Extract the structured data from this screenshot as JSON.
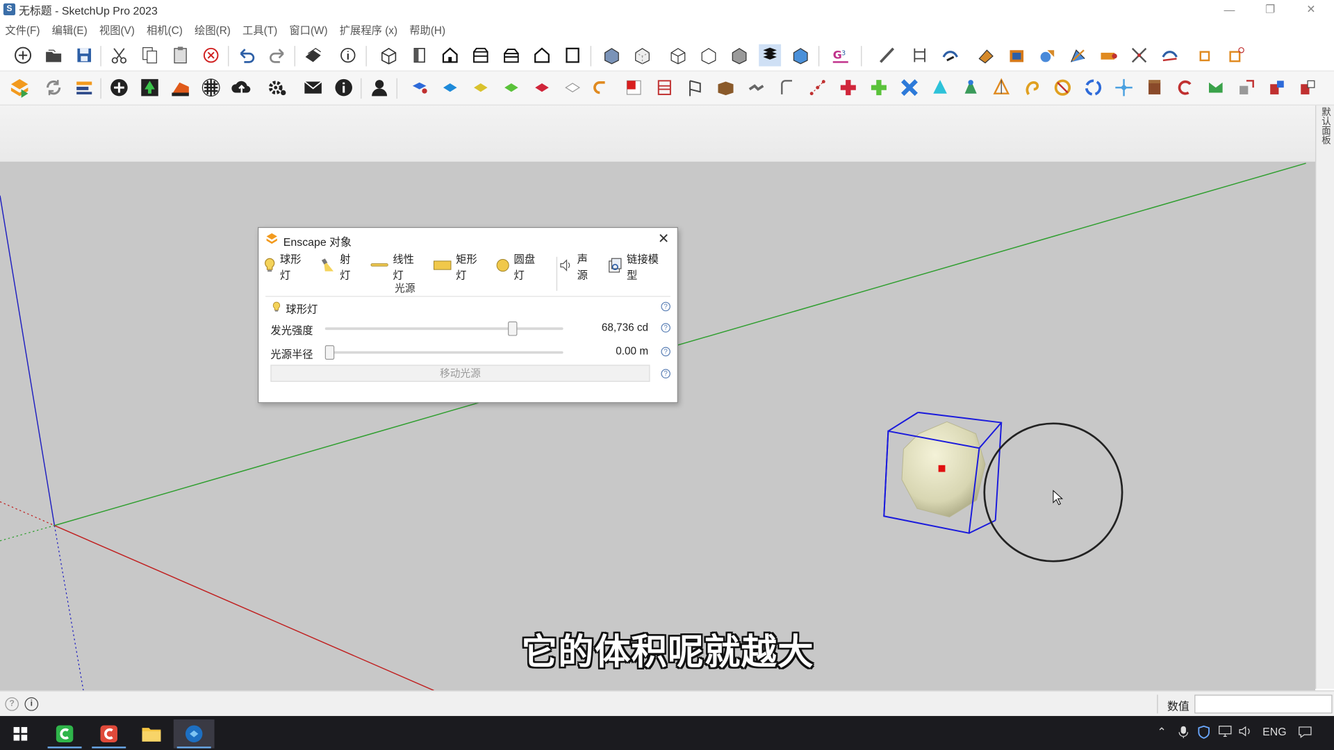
{
  "window": {
    "title": "无标题 - SketchUp Pro 2023",
    "app_icon": "sketchup-logo",
    "controls": [
      "minimize-icon",
      "restore-icon",
      "close-icon"
    ]
  },
  "menu": [
    "文件(F)",
    "编辑(E)",
    "视图(V)",
    "相机(C)",
    "绘图(R)",
    "工具(T)",
    "窗口(W)",
    "扩展程序 (x)",
    "帮助(H)"
  ],
  "toolbar_row1_icons": [
    "new-icon",
    "open-icon",
    "save-icon",
    "cut-icon",
    "copy-icon",
    "paste-icon",
    "erase-icon",
    "undo-icon",
    "redo-icon",
    "print-icon",
    "model-info-icon",
    "iso-view-icon",
    "top-view-icon",
    "front-view-icon",
    "right-view-icon",
    "back-view-icon",
    "left-view-icon",
    "bottom-view-icon",
    "xray-icon",
    "back-edges-icon",
    "wireframe-icon",
    "hidden-line-icon",
    "shaded-icon",
    "shaded-textures-icon",
    "monochrome-icon",
    "section-plane-icon",
    "line-tool-icon",
    "dimension-icon",
    "follow-me-icon",
    "paint-bucket-icon",
    "push-pull-icon",
    "offset-icon",
    "intersect-icon",
    "tape-icon",
    "trim-icon",
    "extend-icon",
    "scale-icon",
    "rotate-icon"
  ],
  "toolbar_row2_icons": [
    "enscape-logo-icon",
    "enscape-refresh-icon",
    "enscape-sync-icon",
    "enscape-add-icon",
    "enscape-asset-icon",
    "enscape-views-icon",
    "enscape-material-icon",
    "enscape-upload-icon",
    "enscape-settings-icon",
    "enscape-feedback-icon",
    "enscape-about-icon",
    "enscape-account-icon",
    "extension-tool-icon"
  ],
  "side_panel": {
    "label": "默认面板"
  },
  "dialog": {
    "title": "Enscape 对象",
    "close_icon": "close-icon",
    "tabs": [
      {
        "label": "球形灯",
        "icon": "bulb-icon"
      },
      {
        "label": "射灯",
        "icon": "spotlight-icon"
      },
      {
        "label": "线性灯",
        "icon": "linear-light-icon"
      },
      {
        "label": "矩形灯",
        "icon": "rect-light-icon"
      },
      {
        "label": "圆盘灯",
        "icon": "disk-light-icon"
      },
      {
        "label": "声源",
        "icon": "speaker-icon"
      },
      {
        "label": "链接模型",
        "icon": "link-model-icon"
      }
    ],
    "group_label": "光源",
    "section_title": "球形灯",
    "intensity": {
      "label": "发光强度",
      "value": "68,736 cd",
      "slider_fraction": 0.8
    },
    "radius": {
      "label": "光源半径",
      "value": "0.00 m",
      "slider_fraction": 0.0
    },
    "move_button": "移动光源"
  },
  "statusbar": {
    "vcb_label": "数值",
    "vcb_value": "",
    "icons": [
      "geo-location-icon",
      "credits-icon"
    ]
  },
  "taskbar": {
    "apps": [
      "windows-start-icon",
      "camtasia-icon",
      "camtasia-recorder-icon",
      "file-explorer-icon",
      "sketchup-icon"
    ],
    "tray_language": "ENG",
    "tray_icons": [
      "chevron-up-icon",
      "microphone-icon",
      "security-shield-icon",
      "network-icon",
      "volume-icon",
      "notification-icon"
    ]
  },
  "subtitle": "它的体积呢就越大",
  "colors": {
    "viewport_bg": "#c8c8c8",
    "axis_green": "#2e9e2e",
    "axis_red": "#c02020",
    "axis_blue": "#2020c0",
    "selection_blue": "#1a1adc",
    "enscape_orange": "#f29a1e"
  }
}
